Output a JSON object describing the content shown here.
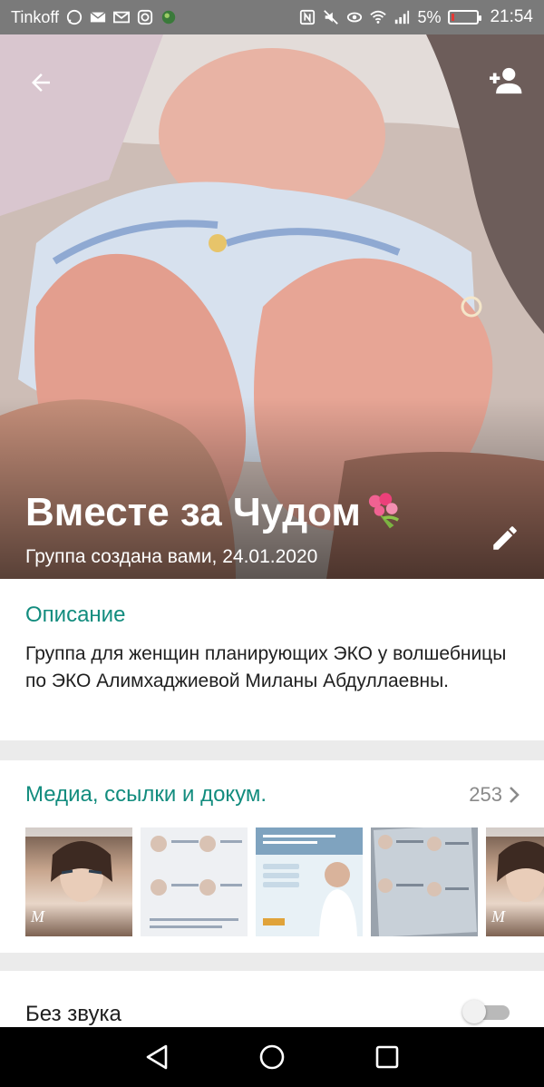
{
  "status_bar": {
    "carrier": "Tinkoff",
    "battery_percent": "5%",
    "time": "21:54",
    "battery_level": 0.05,
    "battery_color": "#e53935"
  },
  "header": {
    "group_name": "Вместе за Чудом",
    "title_emoji": "bouquet-icon",
    "created_info": "Группа создана вами, 24.01.2020",
    "back_icon": "arrow-back-icon",
    "add_participant_icon": "person-add-icon",
    "edit_icon": "pencil-icon"
  },
  "description": {
    "title": "Описание",
    "text": "Группа для женщин планирующих ЭКО у волшебницы по ЭКО Алимхаджиевой Миланы Абдуллаевны."
  },
  "media": {
    "title": "Медиа, ссылки и докум.",
    "count": "253",
    "thumbnails": [
      "magazine-cover",
      "document-scan",
      "clinic-flyer",
      "document-photo",
      "magazine-cover"
    ]
  },
  "settings": {
    "mute_label": "Без звука",
    "mute_enabled": false
  },
  "colors": {
    "accent": "#128c7e",
    "divider": "#ebebeb",
    "count_gray": "#8a8a8a"
  }
}
